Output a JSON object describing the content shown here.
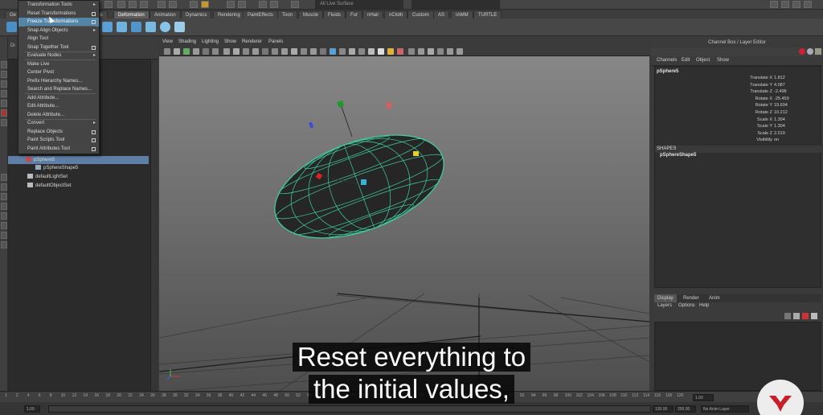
{
  "shelf_tabs": [
    "Ge",
    "ons",
    "Deformation",
    "Animation",
    "Dynamics",
    "Rendering",
    "PaintEffects",
    "Toon",
    "Muscle",
    "Fluids",
    "Fur",
    "nHair",
    "nCloth",
    "Custom",
    "AS",
    "IAMM",
    "TURTLE"
  ],
  "active_shelf_tab": "Deformation",
  "status_text": "All Live Surface",
  "menu": {
    "items": [
      {
        "label": "Transformation Tools",
        "suffix": "arrow"
      },
      {
        "label": "Reset Transformations",
        "suffix": "option"
      },
      {
        "label": "Freeze Transformations",
        "suffix": "option",
        "highlighted": true
      },
      {
        "label": "Snap Align Objects",
        "suffix": "arrow"
      },
      {
        "label": "Align Tool",
        "suffix": ""
      },
      {
        "label": "Snap Together Tool",
        "suffix": "option"
      },
      {
        "label": "Evaluate Nodes",
        "suffix": "arrow"
      },
      {
        "label": "Make Live",
        "suffix": ""
      },
      {
        "label": "Center Pivot",
        "suffix": ""
      },
      {
        "label": "Prefix Hierarchy Names...",
        "suffix": ""
      },
      {
        "label": "Search and Replace Names...",
        "suffix": ""
      },
      {
        "label": "Add Attribute...",
        "suffix": ""
      },
      {
        "label": "Edit Attribute...",
        "suffix": ""
      },
      {
        "label": "Delete Attribute...",
        "suffix": ""
      },
      {
        "label": "Convert",
        "suffix": "arrow"
      },
      {
        "label": "Replace Objects",
        "suffix": "option"
      },
      {
        "label": "Paint Scripts Tool",
        "suffix": "option"
      },
      {
        "label": "Paint Attributes Tool",
        "suffix": "option"
      }
    ]
  },
  "outliner": {
    "label": "Di",
    "items": [
      {
        "label": "pSphere5",
        "selected": true
      },
      {
        "label": "pSphereShape5",
        "selected": false
      },
      {
        "label": "defaultLightSet",
        "selected": false
      },
      {
        "label": "defaultObjectSet",
        "selected": false
      }
    ]
  },
  "viewport_menu": [
    "View",
    "Shading",
    "Lighting",
    "Show",
    "Renderer",
    "Panels"
  ],
  "channel_box": {
    "title": "Channel Box / Layer Editor",
    "tabs": [
      "Channels",
      "Edit",
      "Object",
      "Show"
    ],
    "object": "pSphere5",
    "attributes": [
      {
        "name": "Translate X",
        "value": "1.812"
      },
      {
        "name": "Translate Y",
        "value": "4.087"
      },
      {
        "name": "Translate Z",
        "value": "-2.498"
      },
      {
        "name": "Rotate X",
        "value": "-25.459"
      },
      {
        "name": "Rotate Y",
        "value": "19.694"
      },
      {
        "name": "Rotate Z",
        "value": "10.212"
      },
      {
        "name": "Scale X",
        "value": "1.304"
      },
      {
        "name": "Scale Y",
        "value": "1.304"
      },
      {
        "name": "Scale Z",
        "value": "2.019"
      },
      {
        "name": "Visibility",
        "value": "on"
      }
    ],
    "shapes_label": "SHAPES",
    "shape": "pSphereShape5"
  },
  "layer_editor": {
    "tabs": [
      "Display",
      "Render",
      "Anim"
    ],
    "active_tab": "Display",
    "menu": [
      "Layers",
      "Options",
      "Help"
    ]
  },
  "timeline_ticks": [
    "1",
    "2",
    "4",
    "6",
    "8",
    "10",
    "12",
    "14",
    "16",
    "18",
    "20",
    "22",
    "24",
    "26",
    "28",
    "30",
    "32",
    "34",
    "36",
    "38",
    "40",
    "42",
    "44",
    "46",
    "48",
    "50",
    "52",
    "54",
    "56",
    "58",
    "60",
    "62",
    "64",
    "66",
    "68",
    "70",
    "72",
    "74",
    "76",
    "78",
    "80",
    "82",
    "84",
    "86",
    "88",
    "90",
    "92",
    "94",
    "96",
    "98",
    "100",
    "102",
    "104",
    "106",
    "108",
    "110",
    "112",
    "114",
    "116",
    "118",
    "120"
  ],
  "current_frame": "1.00",
  "range": {
    "start": "1.00",
    "end_a": "120.00",
    "end_b": "200.00",
    "layer": "No Anim Layer"
  },
  "subtitle": {
    "line1": "Reset everything to",
    "line2": "the initial values,"
  },
  "colors": {
    "highlight": "#5285a6",
    "wireframe": "#3fd1a4",
    "logo_red": "#c8202a"
  }
}
